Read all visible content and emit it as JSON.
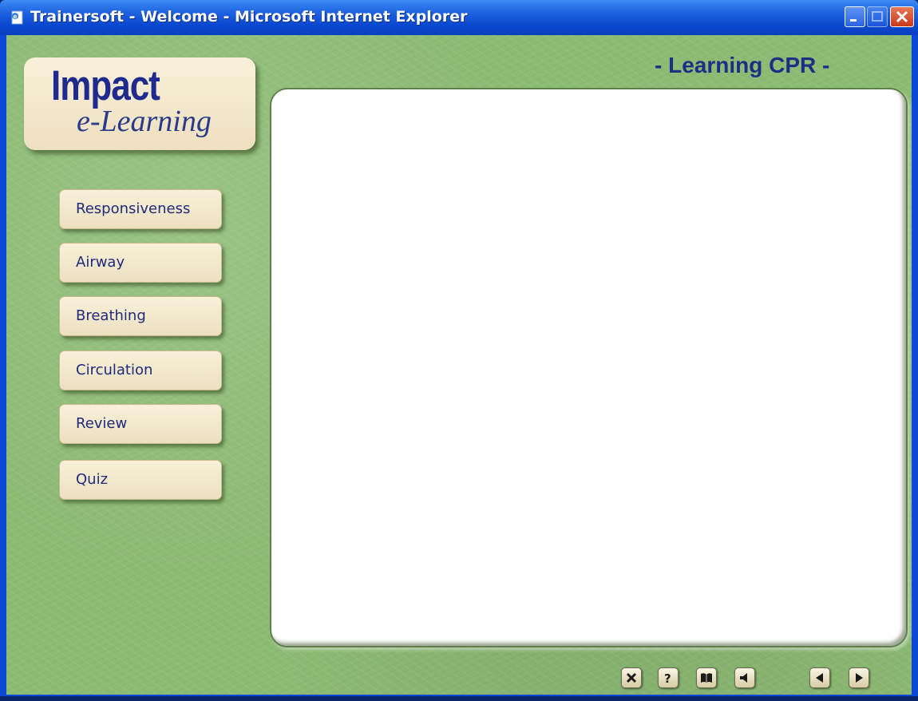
{
  "window": {
    "title": "Trainersoft - Welcome - Microsoft Internet Explorer"
  },
  "logo": {
    "line1": "Impact",
    "line2": "e-Learning"
  },
  "page_heading": "- Learning CPR -",
  "nav": {
    "items": [
      {
        "label": "Responsiveness"
      },
      {
        "label": "Airway"
      },
      {
        "label": "Breathing"
      },
      {
        "label": "Circulation"
      },
      {
        "label": "Review"
      },
      {
        "label": "Quiz"
      }
    ]
  },
  "controls": {
    "icons": [
      "exit-icon",
      "help-icon",
      "glossary-book-icon",
      "audio-speaker-icon",
      "previous-arrow-icon",
      "next-arrow-icon"
    ]
  },
  "colors": {
    "background_green": "#8cbb74",
    "button_cream": "#f4ead0",
    "text_navy": "#1f2a7a"
  }
}
